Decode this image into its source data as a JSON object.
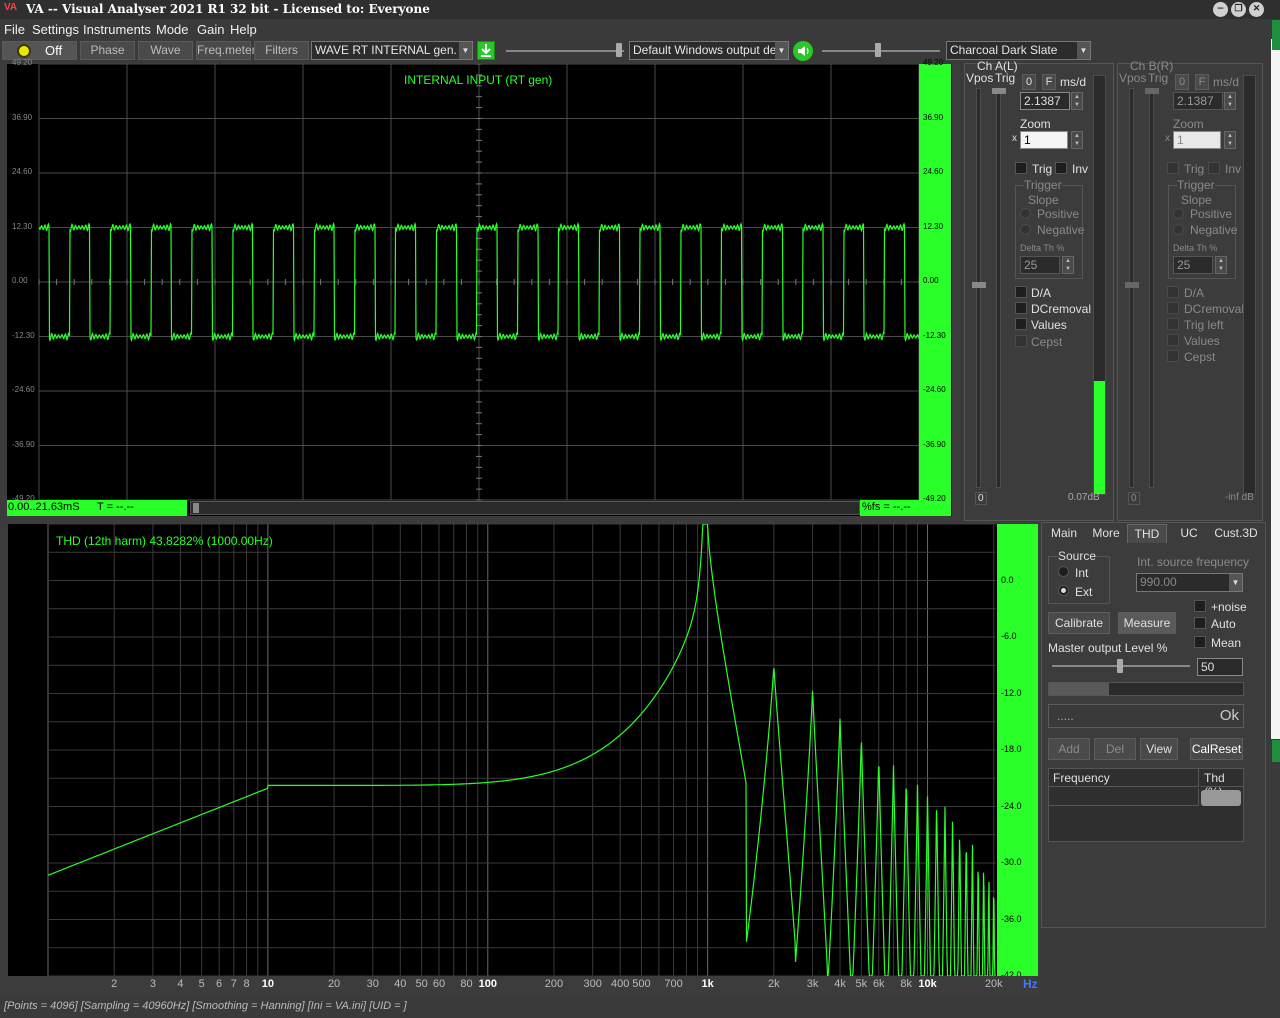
{
  "window": {
    "logo": "VA",
    "title": "VA -- Visual Analyser 2021 R1 32 bit - Licensed to: Everyone",
    "buttons": [
      "−",
      "❐",
      "✕"
    ]
  },
  "menu": [
    "File",
    "Settings",
    "Instruments",
    "Mode",
    "Gain",
    "Help"
  ],
  "toolbar": {
    "power_label": "Off",
    "buttons": [
      "Phase",
      "Wave",
      "Freq.meter",
      "Filters"
    ],
    "generator_combo": "WAVE RT INTERNAL gen.",
    "output_combo": "Default Windows output devic",
    "theme_combo": "Charcoal Dark Slate"
  },
  "scope": {
    "title": "INTERNAL INPUT (RT gen)",
    "y_ticks_left": [
      "49.20",
      "36.90",
      "24.60",
      "12.30",
      "0.00",
      "-12.30",
      "-24.60",
      "-36.90",
      "-49.20"
    ],
    "y_ticks_right": [
      "49.20",
      "36.90",
      "24.60",
      "12.30",
      "0.00",
      "-12.30",
      "-24.60",
      "-36.90",
      "-49.20"
    ],
    "time_readout": "0.00..21.63mS",
    "t_readout": "T = --.--",
    "fs_readout": "%fs = --.--"
  },
  "cha": {
    "title": "Ch A(L)",
    "vpos": "Vpos",
    "trig": "Trig",
    "btn_0": "0",
    "btn_f": "F",
    "unit": "ms/d",
    "msd_value": "2.1387",
    "zoom_label": "Zoom",
    "zoom_x": "x",
    "zoom_value": "1",
    "trig_label": "Trig",
    "inv_label": "Inv",
    "trigger_group": "Trigger",
    "slope": "Slope",
    "positive": "Positive",
    "negative": "Negative",
    "delta": "Delta Th %",
    "delta_value": "25",
    "checks": [
      "D/A",
      "DCremoval",
      "Values",
      "Cepst"
    ],
    "vpos_zero": "0",
    "level": "0.07dB",
    "level_fraction": 0.27
  },
  "chb": {
    "title": "Ch B(R)",
    "vpos": "Vpos",
    "trig": "Trig",
    "btn_0": "0",
    "btn_f": "F",
    "unit": "ms/d",
    "msd_value": "2.1387",
    "zoom_label": "Zoom",
    "zoom_x": "x",
    "zoom_value": "1",
    "trig_label": "Trig",
    "inv_label": "Inv",
    "trigger_group": "Trigger",
    "slope": "Slope",
    "positive": "Positive",
    "negative": "Negative",
    "delta": "Delta Th %",
    "delta_value": "25",
    "checks": [
      "D/A",
      "DCremoval",
      "Trig left",
      "Values",
      "Cepst"
    ],
    "vpos_zero": "0",
    "level": "-inf dB"
  },
  "spectrum": {
    "title": "THD (12th harm) 43.8282% (1000.00Hz)",
    "y_ticks": [
      "0.0",
      "-6.0",
      "-12.0",
      "-18.0",
      "-24.0",
      "-30.0",
      "-36.0",
      "-42.0"
    ],
    "x_ticks": [
      "2",
      "3",
      "4",
      "5",
      "6",
      "7",
      "8",
      "10",
      "20",
      "30",
      "40",
      "50",
      "60",
      "80",
      "100",
      "200",
      "300",
      "400",
      "500",
      "700",
      "1k",
      "2k",
      "3k",
      "4k",
      "5k",
      "6k",
      "8k",
      "10k",
      "20k"
    ],
    "x_unit": "Hz"
  },
  "tabs": [
    "Main",
    "More",
    "THD",
    "UC",
    "Cust.3D"
  ],
  "thd_panel": {
    "source_group": "Source",
    "int_label": "Int",
    "ext_label": "Ext",
    "int_freq_label": "Int. source frequency",
    "int_freq_value": "990.00",
    "noise_label": "+noise",
    "auto_label": "Auto",
    "mean_label": "Mean",
    "calibrate": "Calibrate",
    "measure": "Measure",
    "master_label": "Master output Level %",
    "master_value": "50",
    "dots": ".....",
    "ok": "Ok",
    "add": "Add",
    "del": "Del",
    "view": "View",
    "calreset": "CalReset",
    "col_freq": "Frequency",
    "col_thd": "Thd (%)"
  },
  "status": "[Points = 4096]  [Sampling = 40960Hz]  [Smoothing = Hanning]  [Ini = VA.ini]  [UID = ]",
  "colors": {
    "trace": "#29ff29",
    "background": "#000000",
    "panel": "#3c3c3c"
  }
}
